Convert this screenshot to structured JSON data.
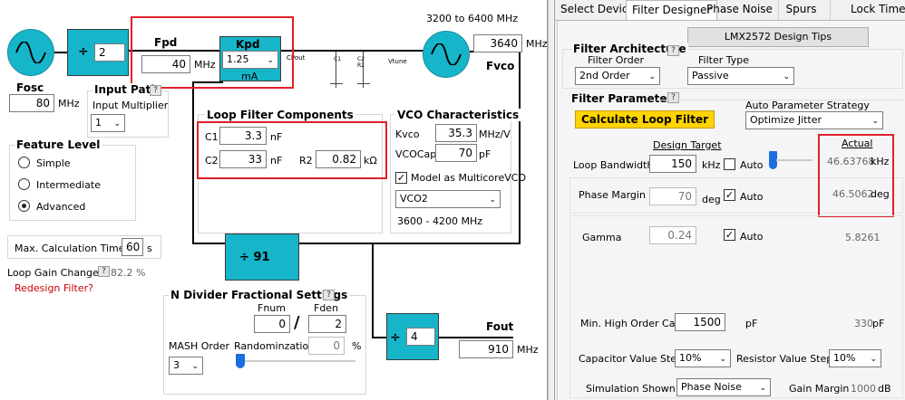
{
  "osc": {
    "label": "Fosc",
    "value": "80",
    "unit": "MHz"
  },
  "r_div": {
    "symbol": "÷",
    "value": "2"
  },
  "fpd": {
    "label": "Fpd",
    "value": "40",
    "unit": "MHz"
  },
  "kpd": {
    "label": "Kpd",
    "value": "1.25",
    "unit": "mA",
    "cpout": "CPout"
  },
  "vco_range_top": "3200 to 6400 MHz",
  "fvco": {
    "label": "Fvco",
    "value": "3640",
    "unit": "MHz",
    "vtune": "Vtune"
  },
  "input_path": {
    "title": "Input Path",
    "multiplier_label": "Input Multiplier",
    "multiplier_value": "1"
  },
  "feature_level": {
    "title": "Feature Level",
    "options": [
      "Simple",
      "Intermediate",
      "Advanced"
    ],
    "selected": "Advanced"
  },
  "max_calc": {
    "label": "Max. Calculation Time",
    "value": "60",
    "unit": "s"
  },
  "loop_gain": {
    "label": "Loop Gain Change",
    "value": "82.2",
    "unit": "%",
    "redesign": "Redesign Filter?"
  },
  "loop_filter": {
    "title": "Loop Filter Components",
    "c1_label": "C1",
    "c1": "3.3",
    "c1_unit": "nF",
    "c2_label": "C2",
    "c2": "33",
    "c2_unit": "nF",
    "r2_label": "R2",
    "r2": "0.82",
    "r2_unit": "kΩ"
  },
  "vco_char": {
    "title": "VCO Characteristics",
    "kvco_label": "Kvco",
    "kvco": "35.3",
    "kvco_unit": "MHz/V",
    "vcocap_label": "VCOCap",
    "vcocap": "70",
    "vcocap_unit": "pF",
    "multicore_label": "Model as MulticoreVCO",
    "vco_select": "VCO2",
    "range": "3600 - 4200 MHz"
  },
  "n_div": {
    "symbol": "÷",
    "value": "91"
  },
  "nfrac": {
    "title": "N Divider Fractional Settings",
    "fnum_label": "Fnum",
    "fnum": "0",
    "fden_label": "Fden",
    "fden": "2",
    "slash": "/",
    "mash_label": "MASH Order",
    "mash": "3",
    "random_label": "Randominzation",
    "random": "0",
    "random_unit": "%"
  },
  "out_div": {
    "symbol": "÷",
    "value": "4"
  },
  "fout": {
    "label": "Fout",
    "value": "910",
    "unit": "MHz"
  },
  "tabs": [
    "Select Device",
    "Filter Designer",
    "Phase Noise",
    "Spurs",
    "Lock Time"
  ],
  "active_tab": "Filter Designer",
  "design_tips": "LMX2572 Design Tips",
  "arch": {
    "title": "Filter Architecture",
    "order_label": "Filter Order",
    "order": "2nd Order",
    "type_label": "Filter Type",
    "type": "Passive"
  },
  "params": {
    "title": "Filter Parameters",
    "calc_btn": "Calculate Loop Filter",
    "strategy_label": "Auto Parameter Strategy",
    "strategy": "Optimize Jitter",
    "design_target": "Design Target",
    "actual": "Actual",
    "lbw_label": "Loop Bandwidth",
    "lbw": "150",
    "lbw_unit": "kHz",
    "auto": "Auto",
    "lbw_actual": "46.63768",
    "lbw_actual_unit": "kHz",
    "pm_label": "Phase Margin",
    "pm": "70",
    "pm_unit": "deg",
    "pm_actual": "46.5062",
    "pm_actual_unit": "deg",
    "gamma_label": "Gamma",
    "gamma": "0.24",
    "gamma_actual": "5.8261",
    "minhoc_label": "Min. High Order Cap",
    "minhoc": "1500",
    "minhoc_unit": "pF",
    "minhoc_actual": "330",
    "minhoc_actual_unit": "pF",
    "capstep_label": "Capacitor Value Step",
    "capstep": "10%",
    "resstep_label": "Resistor Value Step",
    "resstep": "10%",
    "sim_label": "Simulation Shown",
    "sim": "Phase Noise",
    "gainmargin_label": "Gain Margin",
    "gainmargin": "1000",
    "gainmargin_unit": "dB"
  }
}
